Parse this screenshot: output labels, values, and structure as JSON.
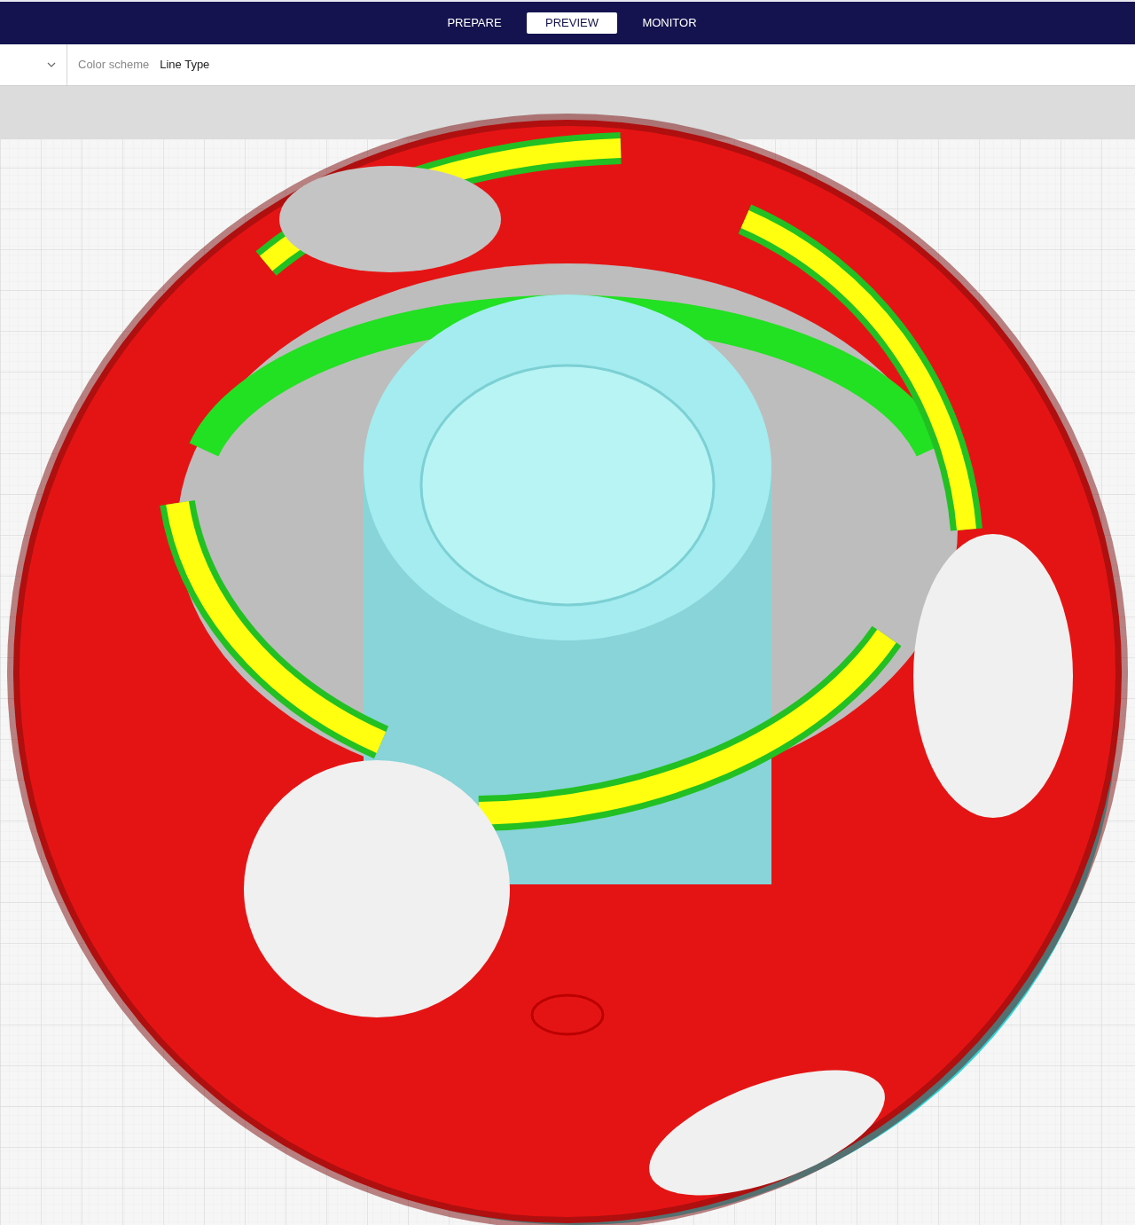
{
  "stage_tabs": [
    {
      "label": "PREPARE",
      "selected": false
    },
    {
      "label": "PREVIEW",
      "selected": true
    },
    {
      "label": "MONITOR",
      "selected": false
    }
  ],
  "view_toolbar": {
    "color_scheme_label": "Color scheme",
    "color_scheme_value": "Line Type"
  }
}
